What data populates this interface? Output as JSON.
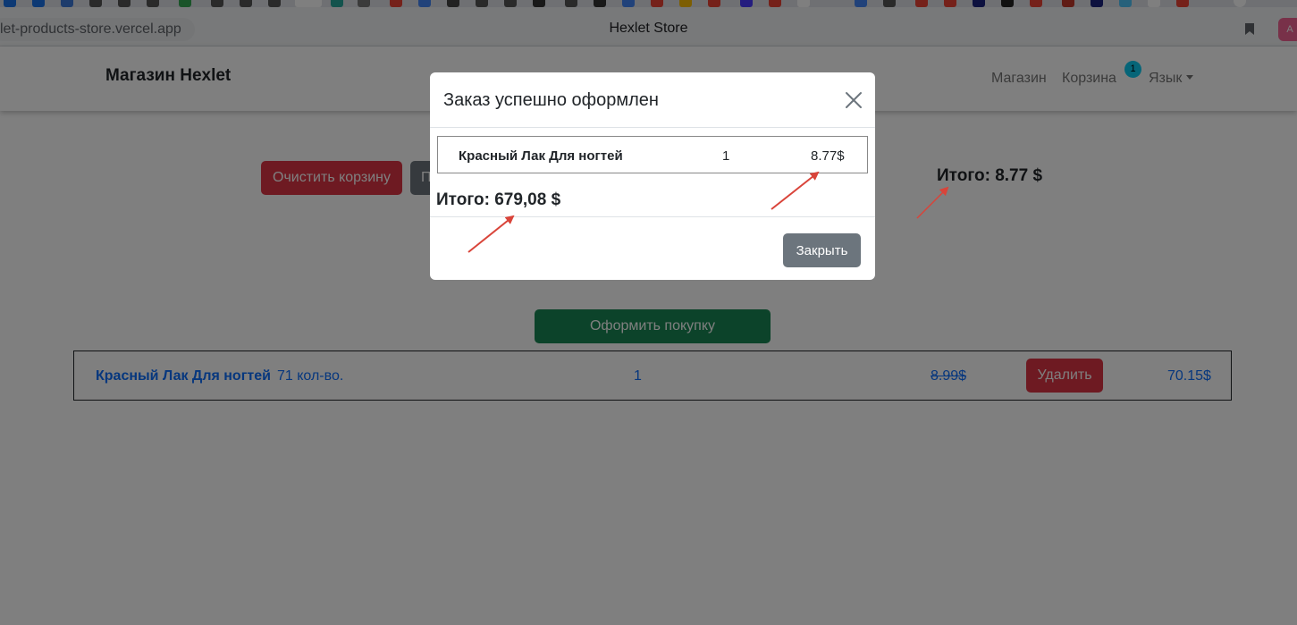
{
  "browser": {
    "url": "let-products-store.vercel.app",
    "title": "Hexlet Store",
    "extension_label": "A"
  },
  "navbar": {
    "brand": "Магазин Hexlet",
    "links": [
      "Магазин",
      "Корзина"
    ],
    "cart_badge": "1",
    "language_label": "Язык"
  },
  "cart": {
    "clear_button": "Очистить корзину",
    "second_button": "П",
    "total": "Итого: 8.77 $",
    "checkout_button": "Оформить покупку",
    "item": {
      "name": "Красный Лак Для ногтей",
      "stock": "71 кол-во.",
      "quantity": "1",
      "old_price": "8.99$",
      "delete_button": "Удалить",
      "price": "70.15$"
    }
  },
  "modal": {
    "title": "Заказ успешно оформлен",
    "item": {
      "name": "Красный Лак Для ногтей",
      "quantity": "1",
      "price": "8.77$"
    },
    "total": "Итого: 679,08 $",
    "close_button": "Закрыть"
  },
  "colors": {
    "danger": "#dc3545",
    "secondary": "#6c757d",
    "success": "#198754",
    "link": "#0d6efd",
    "annotation_arrow": "#d9443a"
  }
}
